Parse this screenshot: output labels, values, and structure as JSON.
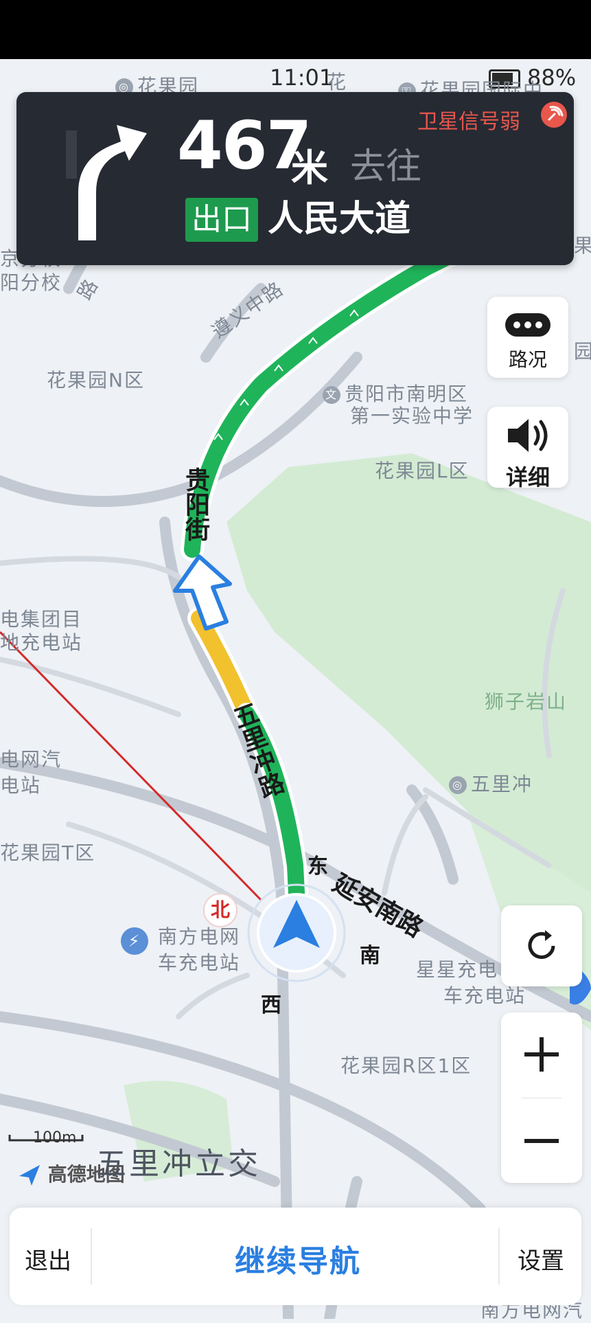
{
  "status_bar": {
    "time": "11:01",
    "battery": "88%"
  },
  "nav": {
    "distance_number": "467",
    "distance_unit": "米",
    "goto": "去往",
    "exit_badge": "出口",
    "road": "人民大道",
    "gps_warning": "卫星信号弱"
  },
  "side_buttons": {
    "traffic": "路况",
    "detail": "详细"
  },
  "map_labels": {
    "top_left_poi": "花果园",
    "top_mid_road": "花",
    "top_right_poi": "花果园国际中",
    "left_school": "京分校",
    "left_school2": "阳分校",
    "road_zy": "遵义中路",
    "road_zy2": "路",
    "area_n": "花果园N区",
    "school": "贵阳市南明区",
    "school2": "第一实验中学",
    "area_l": "花果园L区",
    "guiyang_st": "贵阳街",
    "charging1": "电集团目",
    "charging2": "地充电站",
    "grid1": "电网汽",
    "grid2": "电站",
    "shizi": "狮子岩山",
    "wulichong": "五里冲",
    "wulichong_road": "五里冲路",
    "area_t": "花果园T区",
    "yanan_road": "延安南路",
    "south_grid1": "南方电网",
    "south_grid2": "车充电站",
    "xingxing1": "星星充电",
    "xingxing2": "车充电站",
    "area_r": "花果园R区1区",
    "bottom_right": "南方电网汽",
    "junction": "五里冲立交",
    "right_edge": "果",
    "right_edge2": "园"
  },
  "compass": {
    "north": "北",
    "east": "东",
    "south": "南",
    "west": "西"
  },
  "scale": "100m",
  "logo": "高德地图",
  "bottom": {
    "exit": "退出",
    "continue": "继续导航",
    "settings": "设置"
  },
  "colors": {
    "route_green": "#1fb45a",
    "route_yellow": "#f2c12e",
    "card_bg": "#262a33",
    "accent_blue": "#2a7fe0",
    "warn_red": "#e8564c"
  }
}
